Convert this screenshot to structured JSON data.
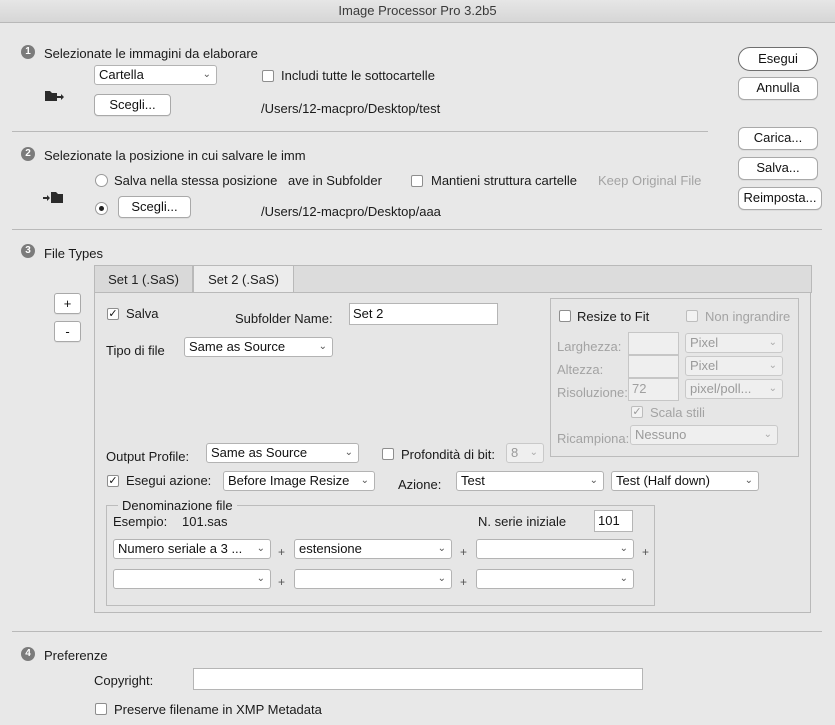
{
  "window": {
    "title": "Image Processor Pro 3.2b5"
  },
  "side_buttons": {
    "run": "Esegui",
    "cancel": "Annulla",
    "load": "Carica...",
    "save": "Salva...",
    "reset": "Reimposta..."
  },
  "section1": {
    "number": "1",
    "title": "Selezionate le immagini da elaborare",
    "source_select": "Cartella",
    "include_subfolders": {
      "label": "Includi tutte le sottocartelle",
      "checked": false
    },
    "choose_button": "Scegli...",
    "path": "/Users/12-macpro/Desktop/test"
  },
  "section2": {
    "number": "2",
    "title": "Selezionate la posizione in cui salvare le imm",
    "same_location": {
      "label": "Salva nella stessa posizione",
      "selected": false
    },
    "save_in_subfolder": "ave in Subfolder",
    "keep_structure": {
      "label": "Mantieni struttura cartelle",
      "checked": false
    },
    "keep_original_file": "Keep Original File",
    "choose_button": "Scegli...",
    "path": "/Users/12-macpro/Desktop/aaa"
  },
  "section3": {
    "number": "3",
    "title": "File Types",
    "add_button": "+",
    "remove_button": "-",
    "tabs": [
      "Set 1 (.SaS)",
      "Set 2 (.SaS)"
    ],
    "active_tab": "Set 2 (.SaS)",
    "save": {
      "label": "Salva",
      "checked": true
    },
    "subfolder_name_label": "Subfolder Name:",
    "subfolder_name_value": "Set 2",
    "file_type_label": "Tipo di file",
    "file_type_value": "Same as Source",
    "resize": {
      "resize_to_fit": "Resize to Fit",
      "no_enlarge": "Non ingrandire",
      "width_label": "Larghezza:",
      "width_unit": "Pixel",
      "height_label": "Altezza:",
      "height_unit": "Pixel",
      "resolution_label": "Risoluzione:",
      "resolution_value": "72",
      "resolution_unit": "pixel/poll...",
      "scale_styles": "Scala stili",
      "resample_label": "Ricampiona:",
      "resample_value": "Nessuno"
    },
    "output_profile_label": "Output Profile:",
    "output_profile_value": "Same as Source",
    "bit_depth_label": "Profondità di bit:",
    "bit_depth_value": "8",
    "run_action": {
      "label": "Esegui azione:",
      "checked": true
    },
    "run_action_when": "Before Image Resize",
    "action_label": "Azione:",
    "action_set": "Test",
    "action_name": "Test (Half down)",
    "naming": {
      "title": "Denominazione file",
      "example_label": "Esempio:",
      "example_value": "101.sas",
      "serial_label": "N. serie iniziale",
      "serial_value": "101",
      "row1": [
        "Numero seriale a 3 ...",
        "estensione",
        ""
      ],
      "row2": [
        "",
        "",
        ""
      ],
      "plus": "+"
    }
  },
  "section4": {
    "number": "4",
    "title": "Preferenze",
    "copyright_label": "Copyright:",
    "copyright_value": "",
    "preserve_filename": {
      "label": "Preserve filename in XMP Metadata",
      "checked": false
    }
  },
  "colors": {
    "window_bg": "#e8e8e8",
    "badge": "#7b7b7b",
    "disabled_text": "#a3a3a3"
  }
}
